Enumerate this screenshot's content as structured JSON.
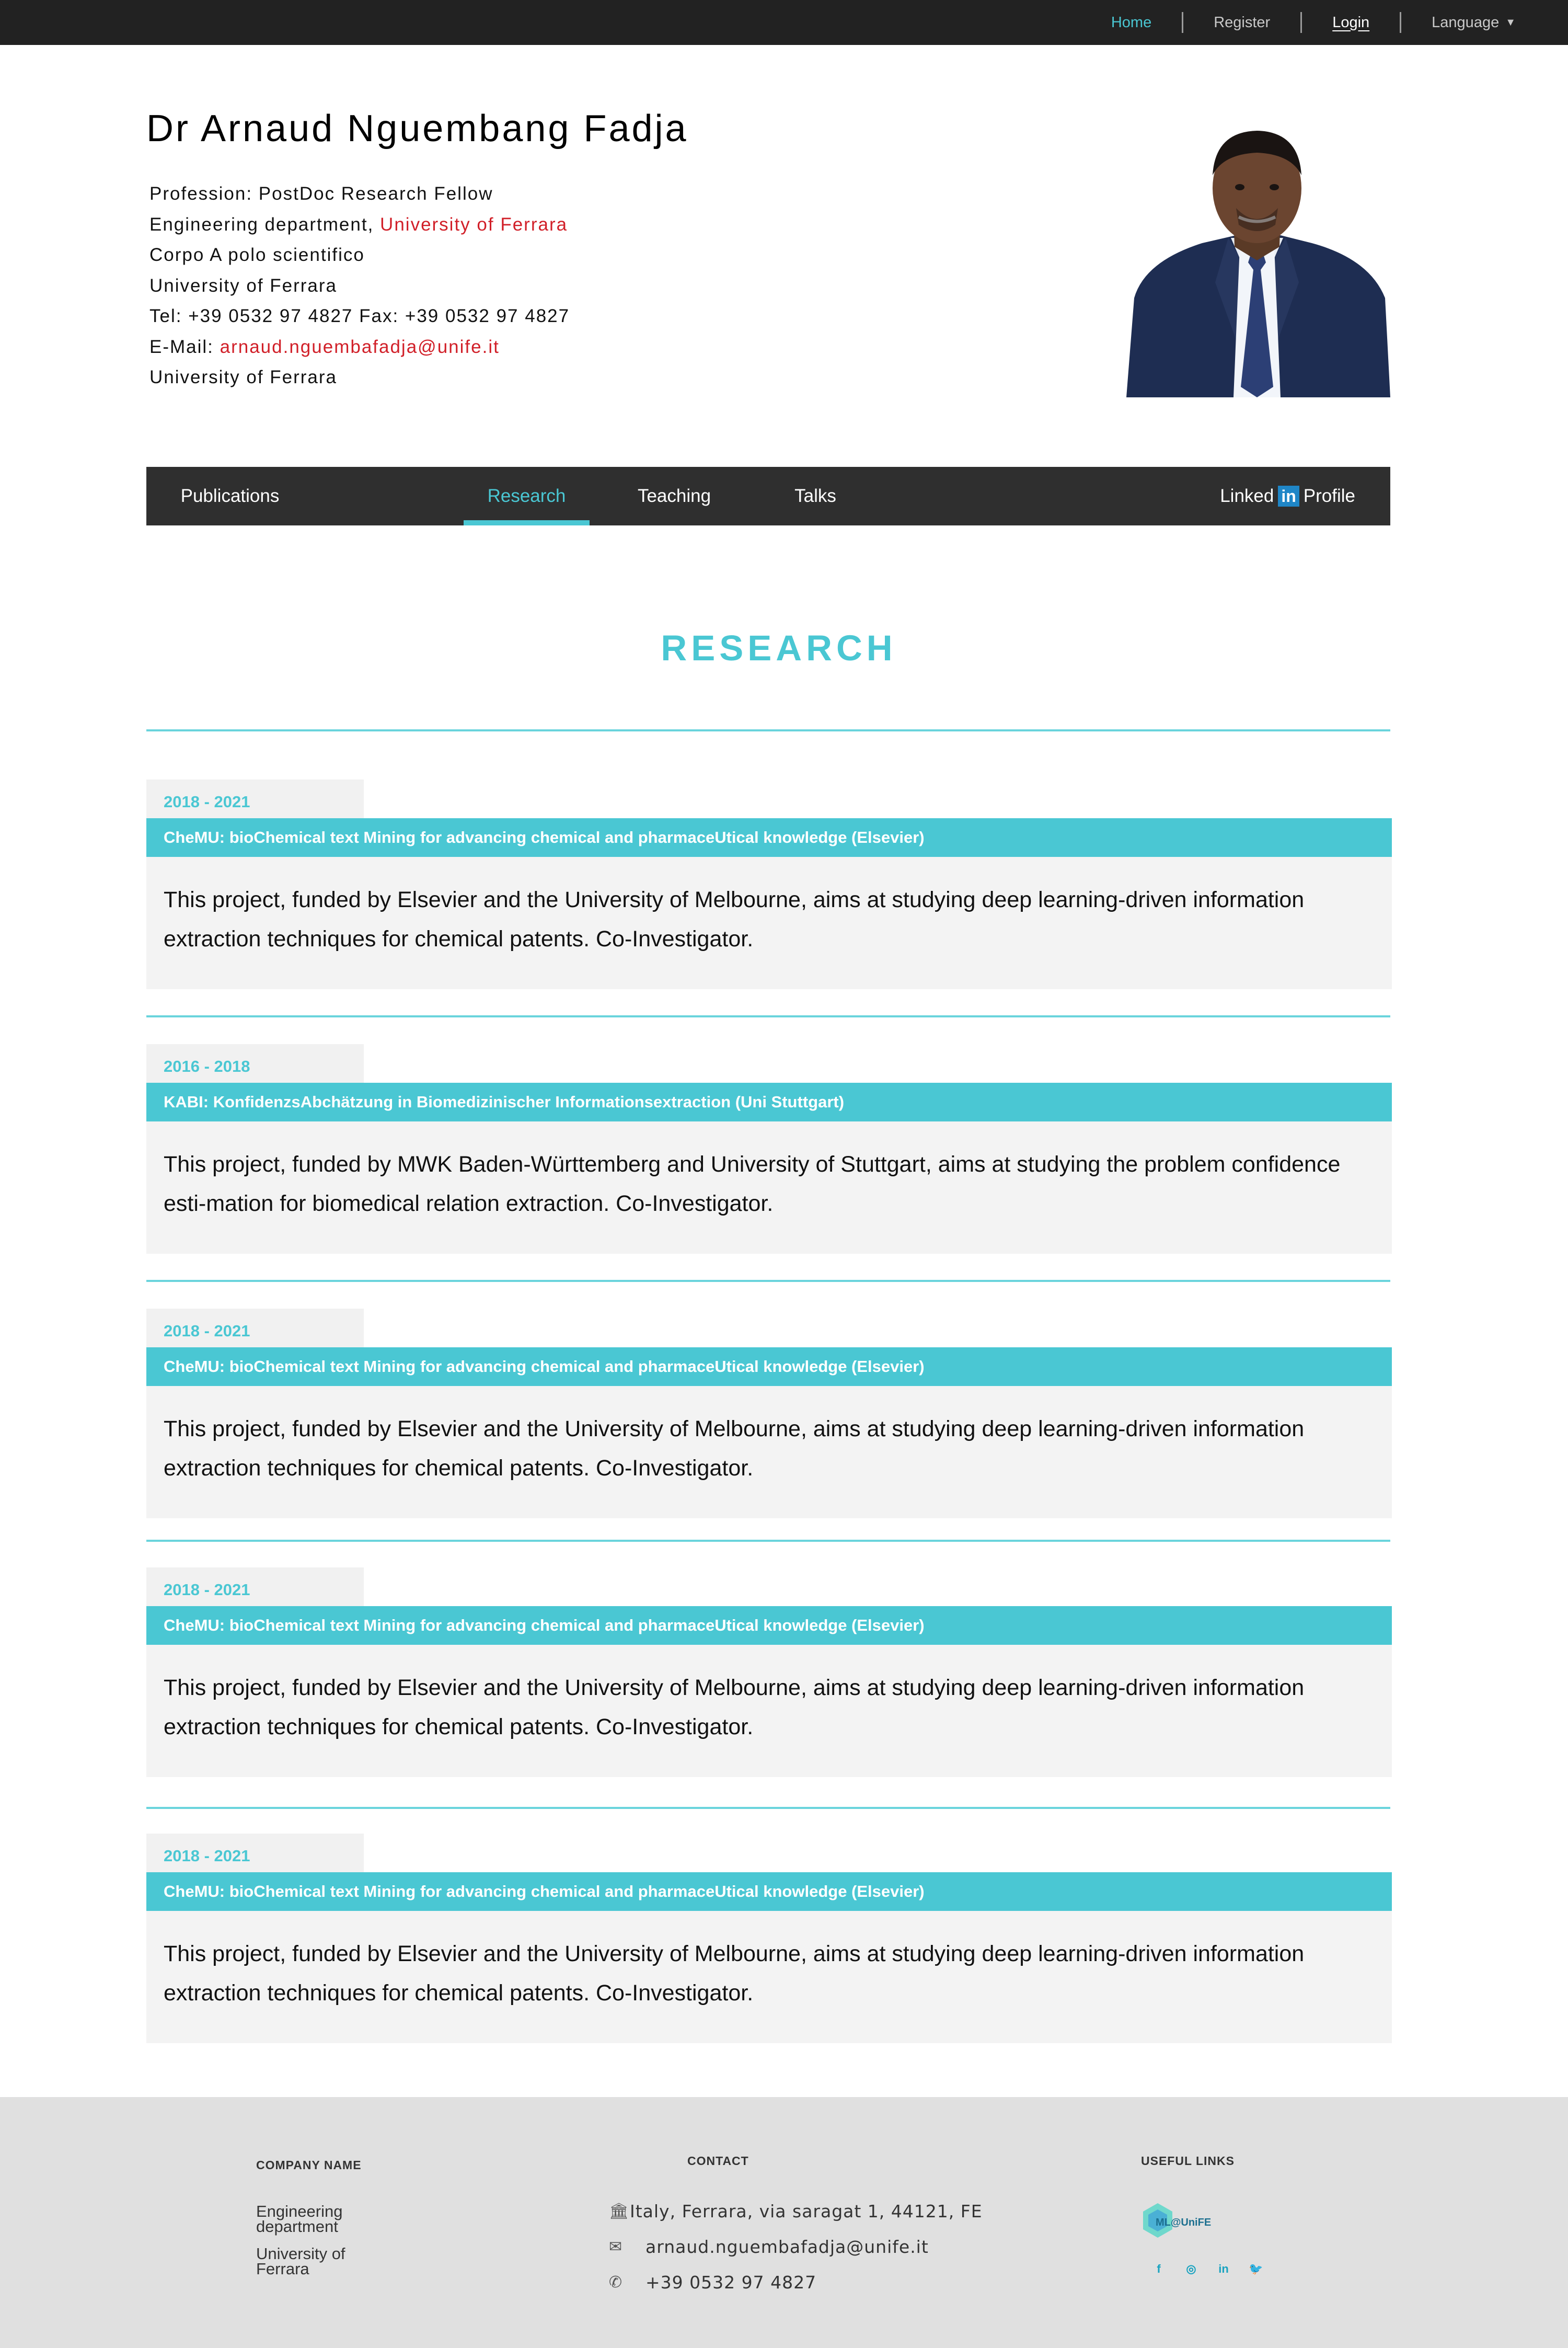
{
  "topnav": {
    "home": "Home",
    "register": "Register",
    "login": "Login",
    "language": "Language"
  },
  "header": {
    "name": "Dr Arnaud Nguembang Fadja",
    "profession": "Profession: PostDoc Research Fellow",
    "department_prefix": "Engineering department, ",
    "department_link": "University of Ferrara",
    "address1": "Corpo A polo scientifico",
    "address2": "University of Ferrara",
    "tel_fax": "Tel: +39 0532 97 4827 Fax: +39 0532 97 4827",
    "email_prefix": "E-Mail: ",
    "email": "arnaud.nguembafadja@unife.it",
    "address3": "University of Ferrara"
  },
  "nav": {
    "tabs": [
      "Publications",
      "Research",
      "Teaching",
      "Talks"
    ],
    "active": "Research",
    "linkedin_pre": "Linked",
    "linkedin_in": "in",
    "linkedin_post": "Profile"
  },
  "section": {
    "title": "RESEARCH"
  },
  "projects": [
    {
      "years": "2018 - 2021",
      "title": "CheMU: bioChemical text Mining for advancing chemical and pharmaceUtical knowledge (Elsevier)",
      "body": "This project, funded by Elsevier and the University of Melbourne, aims at studying deep learning-driven information extraction techniques for chemical patents. Co-Investigator."
    },
    {
      "years": "2016 - 2018",
      "title": "KABI: KonfidenzsAbchätzung in Biomedizinischer Informationsextraction (Uni Stuttgart)",
      "body": "This project, funded by MWK Baden-Württemberg and University of Stuttgart, aims at studying the problem confidence esti-mation for biomedical relation extraction. Co-Investigator."
    },
    {
      "years": "2018 - 2021",
      "title": "CheMU: bioChemical text Mining for advancing chemical and pharmaceUtical knowledge (Elsevier)",
      "body": "This project, funded by Elsevier and the University of Melbourne, aims at studying deep learning-driven information extraction techniques for chemical patents. Co-Investigator."
    },
    {
      "years": "2018 - 2021",
      "title": "CheMU: bioChemical text Mining for advancing chemical and pharmaceUtical knowledge (Elsevier)",
      "body": "This project, funded by Elsevier and the University of Melbourne, aims at studying deep learning-driven information extraction techniques for chemical patents. Co-Investigator."
    },
    {
      "years": "2018 - 2021",
      "title": "CheMU: bioChemical text Mining for advancing chemical and pharmaceUtical knowledge (Elsevier)",
      "body": "This project, funded by Elsevier and the University of Melbourne, aims at studying deep learning-driven information extraction techniques for chemical patents. Co-Investigator."
    }
  ],
  "footer": {
    "company_heading": "COMPANY NAME",
    "company_line1": "Engineering department",
    "company_line2": "University of Ferrara",
    "contact_heading": "CONTACT",
    "address": "Italy, Ferrara, via saragat 1, 44121, FE",
    "email": "arnaud.nguembafadja@unife.it",
    "phone": "+39 0532 97 4827",
    "links_heading": "USEFUL LINKS",
    "logo_text": "ML@UniFE",
    "social": [
      "facebook-icon",
      "instagram-icon",
      "linkedin-icon",
      "twitter-icon"
    ]
  },
  "colors": {
    "accent": "#4ac7d3",
    "topbar": "#222222",
    "navbar": "#2f2f2f",
    "link_red": "#d11f28",
    "footer_bg": "#e0e0e0"
  }
}
